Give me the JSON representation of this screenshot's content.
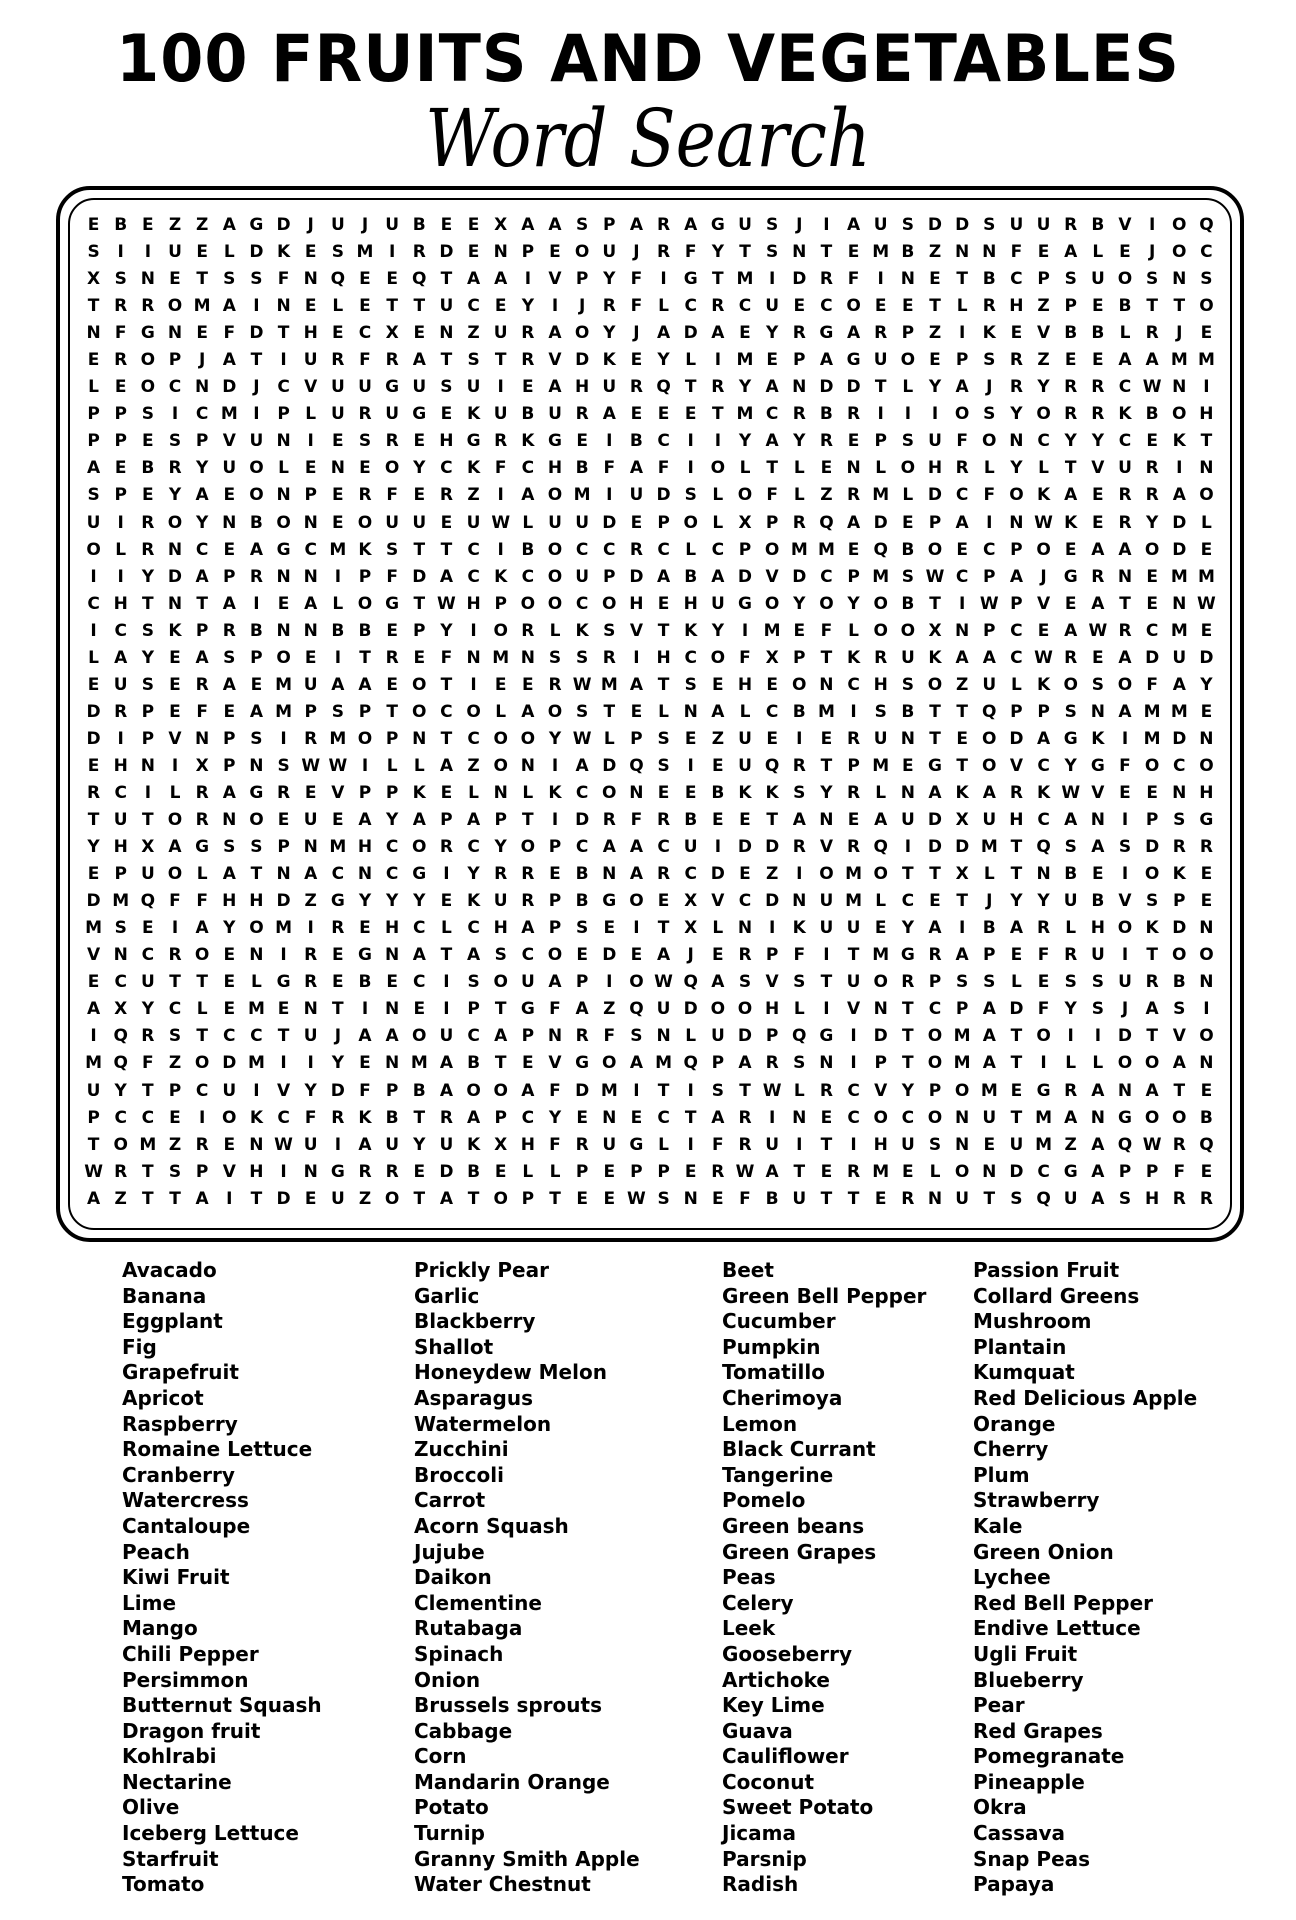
{
  "title": {
    "line1": "100 FRUITS AND VEGETABLES",
    "line2": "Word Search"
  },
  "grid": {
    "rows": [
      "EBEZZAGDJUJUBEEXAASPARAGUSJIAUSDDSUURBVIOQ",
      "SIIUELDKESMIRDENPEOUJRFYTSNTEMBZNNFEALEJOC",
      "XSNETSSFNQEEQTAAIVPYFIGTMIDRFINETBCPSUOSNS",
      "TRROMAINELETTUCEYIJRFLCRCUECOEETLRHZPEBTTO",
      "NFGNEFDTHECXENZURAOYJADAEYRGARPZIKEVBBLRJE",
      "EROPJATIURFRATSTRVDKEYLIMEPAGUOEPSRZEEAAMM",
      "LEOCNDJCVUUGUSUIEAHURQTRYANDDTLYAJRYRRCWNI",
      "PPSICMIPLURUGEKUBURAEEETMCRBRIIIOSYORRKBOH",
      "PPESPVUNIESREHGRKGEIBCIIYAYREPSUFONCYYCEKT",
      "AEBRYUOLENEOYCKFCHBFAFIOLTLENLOHRLYLTVURIN",
      "SPEYAEONPERFERZIAOMIUDSLOFLZRMLDCFOKAERRAO",
      "UIROYNBONEOUUEUWLUUDEPOLXPRQADEPAINWKERYDL",
      "OLRNCEAGCMKSTTCIBOCCRCLCPOMMEQBOECPOEAAODE",
      "IIYDAPRNNIPFDACKCOUPDABADVDCPMSWCPAJGRNEMM",
      "CHTNTAIEALOGTWHPOOCOHEHUGOYOYOBTIWPVEATENW",
      "ICSKPRBNNBBEPYIORLKSVTKYIMEFLOOXNPCEAWRCME",
      "LAYEASPOEITREFNMNSSRIHCOFXPTKRUKAACWREADUD",
      "EUSERAEMUAAEOTIEERWMATSEHEONCHSOZULKOSOFAY",
      "DRPEFEAMPSPTOCOLAOSTELNALCBMISBTTQPPSNAMME",
      "DIPVNPSIRMOPNTCOOYWLPSEZUEIERUNTEODAGKIMDN",
      "EHNIXPNSWWILLAZONIADQSIEUQRTPMEGTOVCYGFOCO",
      "RCILRAGREVPPKELNLKCONEEBKKSYRLNAKARKWVEENH",
      "TUTORNOEUEAYAPAPTIDRFRBEETANEAUDXUHCANIPSG",
      "YHXAGSSPNMHCORCYOPCAACUIDDRVRQIDDMTQSASDRR",
      "EPUOLATNACNCGIYRREBNARCDEZIOMOTTXLTNBEIOKE",
      "DMQFFHHDZGYYYEKURPBGOEXVCDNUMLCETJYYUBVSPE",
      "MSEIAYOMIREHCLCHAPSEITXLNIKUUEYAIBARLHOKDN",
      "VNCROENIREGNATASCOEDEAJERPFITMGRAPEFRUITOO",
      "ECUTTELGREBECISOUAPIOWQASVSTUORPSSLESSURBN",
      "AXYCLEMENTINEIPTGFAZQUDOOHLIVNTCPADFYSJASI",
      "IQRSTCCTUJAAOUCAPNRFSNLUDPQGIDTOMATOIIDTVO",
      "MQFZODMIIYENMABTEVGOAMQPARSNIPTOMATILLOOAN",
      "UYTPCUIVYDFPBAOOAFDMITISTWLRCVYPOMEGRANATE",
      "PCCEIOKCFRKBTRAPCYENECTARINECOCONUTMANGOOB",
      "TOMZRENWUIAUYUKXHFRUGLIFRUITIHUSNEUMZAQWRQ",
      "WRTSPVHINGRREDBELLPEPPERWATERMELONDCGAPPFE",
      "AZTTAITDEUZOTATOPTEEWSNEFBUTTERNUTSQUASHRR"
    ]
  },
  "word_list": {
    "columns": [
      [
        "Avacado",
        "Banana",
        "Eggplant",
        "Fig",
        "Grapefruit",
        "Apricot",
        "Raspberry",
        "Romaine Lettuce",
        "Cranberry",
        "Watercress",
        "Cantaloupe",
        "Peach",
        "Kiwi Fruit",
        "Lime",
        "Mango",
        "Chili Pepper",
        "Persimmon",
        "Butternut Squash",
        "Dragon fruit",
        "Kohlrabi",
        "Nectarine",
        "Olive",
        "Iceberg Lettuce",
        "Starfruit",
        "Tomato"
      ],
      [
        "Prickly Pear",
        "Garlic",
        "Blackberry",
        "Shallot",
        "Honeydew Melon",
        "Asparagus",
        "Watermelon",
        "Zucchini",
        "Broccoli",
        "Carrot",
        "Acorn Squash",
        "Jujube",
        "Daikon",
        "Clementine",
        "Rutabaga",
        "Spinach",
        "Onion",
        "Brussels sprouts",
        "Cabbage",
        "Corn",
        "Mandarin Orange",
        "Potato",
        "Turnip",
        "Granny Smith Apple",
        "Water Chestnut"
      ],
      [
        "Beet",
        "Green Bell Pepper",
        "Cucumber",
        "Pumpkin",
        "Tomatillo",
        "Cherimoya",
        "Lemon",
        "Black Currant",
        "Tangerine",
        "Pomelo",
        "Green beans",
        "Green Grapes",
        "Peas",
        "Celery",
        "Leek",
        "Gooseberry",
        "Artichoke",
        "Key Lime",
        "Guava",
        "Cauliflower",
        "Coconut",
        "Sweet Potato",
        "Jicama",
        "Parsnip",
        "Radish"
      ],
      [
        "Passion Fruit",
        "Collard Greens",
        "Mushroom",
        "Plantain",
        "Kumquat",
        "Red Delicious Apple",
        "Orange",
        "Cherry",
        "Plum",
        "Strawberry",
        "Kale",
        "Green Onion",
        "Lychee",
        "Red Bell Pepper",
        "Endive Lettuce",
        "Ugli Fruit",
        "Blueberry",
        "Pear",
        "Red Grapes",
        "Pomegranate",
        "Pineapple",
        "Okra",
        "Cassava",
        "Snap Peas",
        "Papaya"
      ]
    ]
  }
}
